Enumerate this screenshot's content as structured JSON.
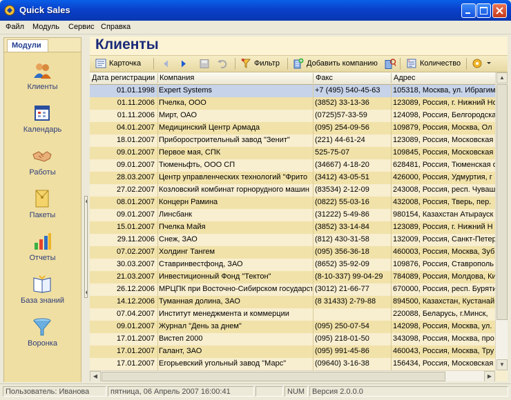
{
  "window": {
    "title": "Quick Sales",
    "accent": "#0A5FE8"
  },
  "menu": [
    "Файл",
    "Модуль",
    "Сервис",
    "Справка"
  ],
  "sidebar": {
    "header": "Модули",
    "modules": [
      {
        "label": "Клиенты",
        "icon": "clients-icon"
      },
      {
        "label": "Календарь",
        "icon": "calendar-icon"
      },
      {
        "label": "Работы",
        "icon": "handshake-icon"
      },
      {
        "label": "Пакеты",
        "icon": "package-icon"
      },
      {
        "label": "Отчеты",
        "icon": "bar-chart-icon"
      },
      {
        "label": "База знаний",
        "icon": "open-book-icon"
      },
      {
        "label": "Воронка",
        "icon": "funnel-icon"
      }
    ]
  },
  "main": {
    "title": "Клиенты",
    "toolbar": {
      "card": "Карточка",
      "filter": "Фильтр",
      "add_company": "Добавить компанию",
      "count": "Количество"
    }
  },
  "table": {
    "columns": [
      "Дата регистрации",
      "Компания",
      "Факс",
      "Адрес"
    ],
    "rows": [
      [
        "01.01.1998",
        "Expert Systems",
        "+7 (495) 540-45-63",
        "105318, Москва, ул. Ибрагимова"
      ],
      [
        "01.11.2006",
        "Пчелка, ООО",
        "(3852) 33-13-36",
        "123089, Россия, г. Нижний Новгород"
      ],
      [
        "01.11.2006",
        "Мирт, ОАО",
        "(0725)57-33-59",
        "124098, Россия, Белгородская"
      ],
      [
        "04.01.2007",
        "Медицинский Центр Армада",
        "(095) 254-09-56",
        "109879, Россия, Москва, Ол"
      ],
      [
        "18.01.2007",
        "Приборостроительный завод \"Зенит\"",
        "(221) 44-61-24",
        "123089, Россия, Московская"
      ],
      [
        "09.01.2007",
        "Первое мая, СПК",
        "525-75-07",
        "109845, Россия, Московская"
      ],
      [
        "09.01.2007",
        "Тюменьфть, ООО СП",
        "(34667) 4-18-20",
        "628481, Россия, Тюменская о"
      ],
      [
        "28.03.2007",
        "Центр управленческих технологий \"Фрито",
        "(3412) 43-05-51",
        "426000, Россия, Удмуртия, г"
      ],
      [
        "27.02.2007",
        "Козловский комбинат горнорудного машин",
        "(83534) 2-12-09",
        "243008, Россия, респ. Чуваш"
      ],
      [
        "08.01.2007",
        "Концерн Рамина",
        "(0822) 55-03-16",
        "432008, Россия, Тверь, пер."
      ],
      [
        "09.01.2007",
        "Линсбанк",
        "(31222) 5-49-86",
        "980154, Казахстан Атырауск"
      ],
      [
        "15.01.2007",
        "Пчелка Майя",
        "(3852) 33-14-84",
        "123089, Россия, г. Нижний Н"
      ],
      [
        "29.11.2006",
        "Снеж, ЗАО",
        "(812) 430-31-58",
        "132009, Россия, Санкт-Петер"
      ],
      [
        "07.02.2007",
        "Холдинг Тангем",
        "(095) 356-36-18",
        "460003, Россия, Москва, Зуб"
      ],
      [
        "30.03.2007",
        "Ставринвестфонд, ЗАО",
        "(8652) 35-92-09",
        "109876, Россия, Ставрополь"
      ],
      [
        "21.03.2007",
        "Инвестиционный Фонд \"Тектон\"",
        "(8-10-337) 99-04-29",
        "784089, Россия, Молдова, Кишинёв"
      ],
      [
        "26.12.2006",
        "МРЦПК при Восточно-Сибирском государст",
        "(3012) 21-66-77",
        "670000, Россия, респ. Бурятия"
      ],
      [
        "14.12.2006",
        "Туманная долина, ЗАО",
        "(8 31433) 2-79-88",
        "894500, Казахстан, Кустанай"
      ],
      [
        "07.04.2007",
        "Институт менеджмента и коммерции",
        "",
        "220088, Беларусь, г.Минск,"
      ],
      [
        "09.01.2007",
        "Журнал \"День за днем\"",
        "(095) 250-07-54",
        "142098, Россия, Москва, ул."
      ],
      [
        "17.01.2007",
        "Вистеп 2000",
        "(095) 218-01-50",
        "343098, Россия, Москва, про"
      ],
      [
        "17.01.2007",
        "Галант, ЗАО",
        "(095) 991-45-86",
        "460043, Россия, Москва, Тру"
      ],
      [
        "17.01.2007",
        "Егорьевский угольный завод \"Марс\"",
        "(09640) 3-16-38",
        "156434, Россия, Московская"
      ]
    ]
  },
  "status": {
    "user": "Пользователь: Иванова",
    "datetime": "пятница, 06 Апрель 2007 16:00:41",
    "num": "NUM",
    "version": "Версия 2.0.0.0"
  }
}
